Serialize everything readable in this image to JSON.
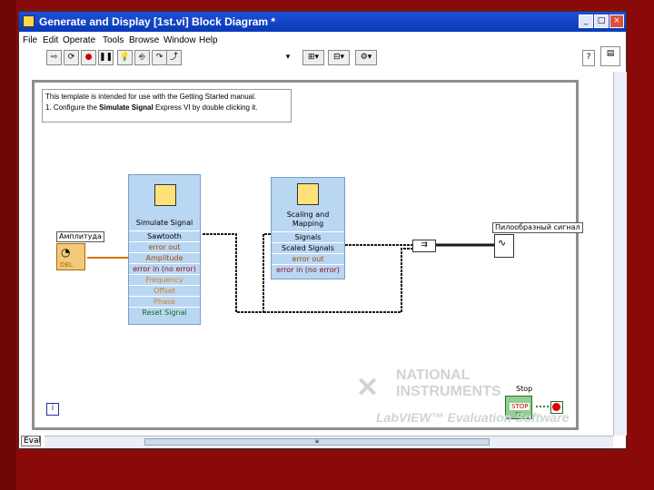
{
  "window": {
    "title": "Generate and Display [1st.vi] Block Diagram *",
    "buttons": {
      "minimize": "_",
      "maximize": "□",
      "close": "×"
    }
  },
  "menu": [
    "File",
    "Edit",
    "Operate",
    "Tools",
    "Browse",
    "Window",
    "Help"
  ],
  "toolbar": {
    "font": "13pt Application Font"
  },
  "note": {
    "line1": "This template is intended for use with the Getting Started manual.",
    "line2_prefix": "1. Configure the ",
    "line2_bold": "Simulate Signal",
    "line2_suffix": " Express VI by double clicking it."
  },
  "simulate": {
    "title": "Simulate Signal",
    "rows": [
      "Sawtooth",
      "error out",
      "Amplitude",
      "error in (no error)",
      "Frequency",
      "Offset",
      "Phase",
      "Reset Signal"
    ]
  },
  "scaling": {
    "title_line1": "Scaling and",
    "title_line2": "Mapping",
    "rows": [
      "Signals",
      "Scaled Signals",
      "error out",
      "error in (no error)"
    ]
  },
  "amplitude_control": {
    "label": "Амплитуда",
    "type": "DBL"
  },
  "graph_indicator": {
    "label": "Пилообразный сигнал"
  },
  "stop_button": {
    "label": "Stop",
    "text": "STOP",
    "type": "TF"
  },
  "info_icon": "i",
  "status": {
    "eval": "Eval"
  },
  "watermark": {
    "line1": "NATIONAL",
    "line2": "INSTRUMENTS",
    "line3": "LabVIEW™ Evaluation Software"
  },
  "colors": {
    "titlebar": "#0a3ab8",
    "node": "#b9d6f2",
    "wire_numeric": "#e07000",
    "slide_background": "#8a0a0a"
  }
}
